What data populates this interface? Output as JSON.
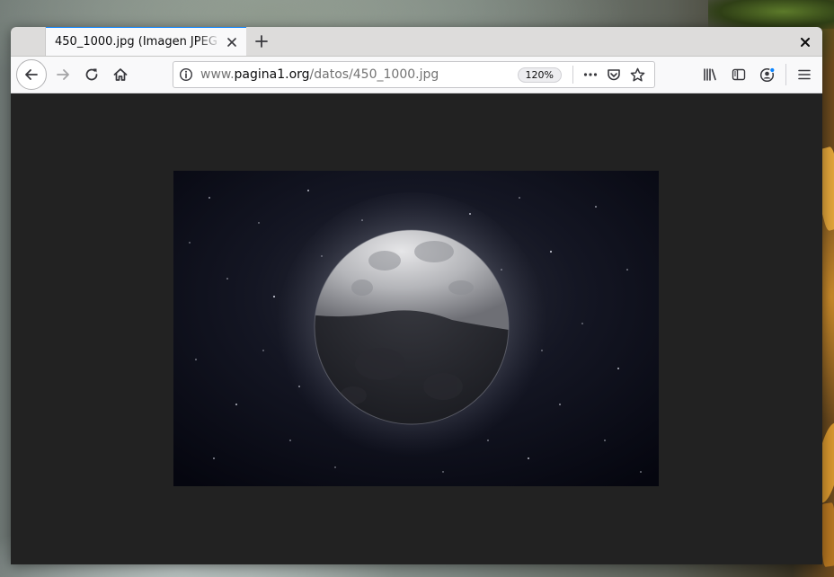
{
  "window": {
    "tab": {
      "title": "450_1000.jpg (Imagen JPEG"
    },
    "url": {
      "prefix": "www.",
      "host": "pagina1.org",
      "path": "/datos/450_1000.jpg"
    },
    "zoom": "120%"
  },
  "icons": {
    "tab_close": "close-icon",
    "new_tab": "plus-icon",
    "window_close": "close-icon",
    "back": "arrow-left-icon",
    "forward": "arrow-right-icon",
    "reload": "reload-icon",
    "home": "home-icon",
    "page_info": "info-icon",
    "page_actions": "more-horizontal-icon",
    "pocket": "pocket-icon",
    "bookmark": "star-icon",
    "library": "library-icon",
    "sidebar": "sidebar-icon",
    "account": "account-icon",
    "menu": "hamburger-menu-icon"
  },
  "colors": {
    "accent": "#0a84ff",
    "viewer_background": "#222222"
  }
}
